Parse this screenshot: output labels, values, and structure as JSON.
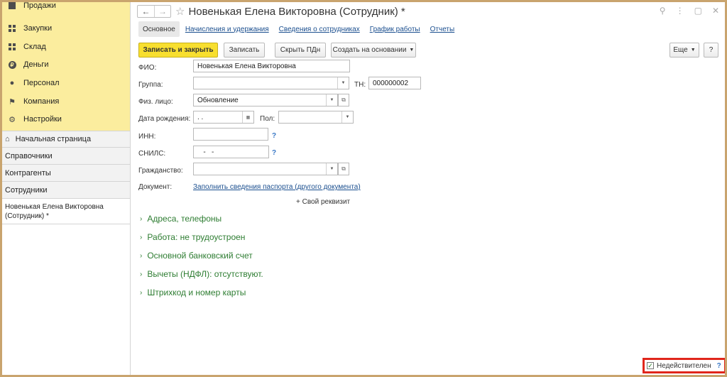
{
  "sidebar": {
    "sections": [
      {
        "label": "Продажи",
        "icon": "sales-icon"
      },
      {
        "label": "Закупки",
        "icon": "purchases-icon"
      },
      {
        "label": "Склад",
        "icon": "warehouse-icon"
      },
      {
        "label": "Деньги",
        "icon": "money-icon"
      },
      {
        "label": "Персонал",
        "icon": "personnel-icon"
      },
      {
        "label": "Компания",
        "icon": "flag-icon"
      },
      {
        "label": "Настройки",
        "icon": "gear-icon"
      }
    ],
    "nav": {
      "home": "Начальная страница",
      "item1": "Справочники",
      "item2": "Контрагенты",
      "item3": "Сотрудники",
      "active": "Новенькая Елена Викторовна (Сотрудник) *"
    }
  },
  "header": {
    "title": "Новенькая Елена Викторовна (Сотрудник) *",
    "back_glyph": "←",
    "forward_glyph": "→",
    "star_glyph": "☆"
  },
  "tabs": {
    "main": "Основное",
    "accruals": "Начисления и удержания",
    "info": "Сведения о сотрудниках",
    "schedule": "График работы",
    "reports": "Отчеты"
  },
  "toolbar": {
    "save_close": "Записать и закрыть",
    "save": "Записать",
    "hide_pd": "Скрыть ПДн",
    "create_based": "Создать на основании",
    "more": "Еще",
    "help": "?"
  },
  "form": {
    "fio_label": "ФИО:",
    "fio_value": "Новенькая Елена Викторовна",
    "group_label": "Группа:",
    "group_value": "",
    "tn_label": "ТН:",
    "tn_value": "000000002",
    "person_label": "Физ. лицо:",
    "person_value": "Обновление",
    "birth_label": "Дата рождения:",
    "birth_value": " .  .",
    "sex_label": "Пол:",
    "sex_value": "",
    "inn_label": "ИНН:",
    "inn_value": "",
    "snils_label": "СНИЛС:",
    "snils_value": "   -   -",
    "citizenship_label": "Гражданство:",
    "citizenship_value": "",
    "document_label": "Документ:",
    "document_link": "Заполнить сведения паспорта (другого документа)",
    "add_requisite": "+ Свой реквизит"
  },
  "groups": {
    "addresses": "Адреса, телефоны",
    "work": "Работа: не трудоустроен",
    "bank": "Основной банковский счет",
    "deductions": "Вычеты (НДФЛ): отсутствуют.",
    "barcode": "Штрихкод и номер карты"
  },
  "footer": {
    "invalid_label": "Недействителен",
    "invalid_checked": true,
    "help": "?"
  }
}
